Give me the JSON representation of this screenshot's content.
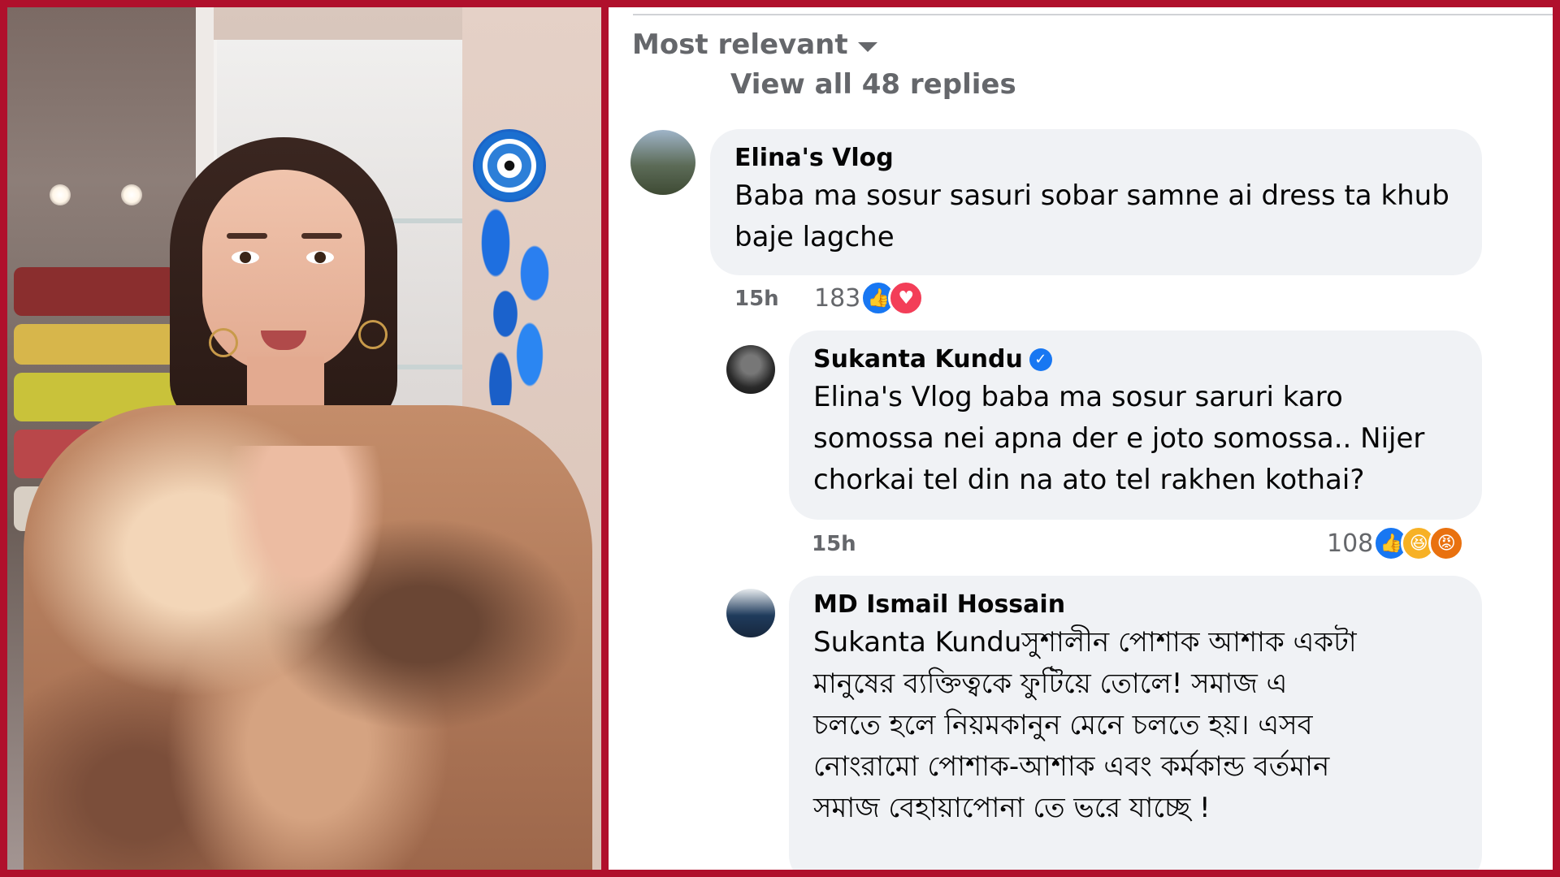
{
  "comments_section": {
    "sort_label": "Most relevant",
    "view_replies": "View all 48 replies",
    "comments": [
      {
        "author": "Elina's Vlog",
        "lines": [
          "Baba ma sosur sasuri sobar samne ai dress ta khub",
          "baje lagche"
        ],
        "time": "15h",
        "reaction_count": "183",
        "reactions": [
          "like-icon",
          "love-icon"
        ],
        "verified": false
      },
      {
        "author": "Sukanta Kundu",
        "lines": [
          "Elina's Vlog baba ma sosur saruri karo",
          "somossa nei apna der e joto somossa.. Nijer",
          "chorkai tel din na ato tel rakhen kothai?"
        ],
        "time": "15h",
        "reaction_count": "108",
        "reactions": [
          "like-icon",
          "haha-icon",
          "angry-icon"
        ],
        "verified": true
      },
      {
        "author": "MD Ismail Hossain",
        "lines": [
          "Sukanta Kunduসুশালীন পোশাক আশাক একটা",
          "মানুষের ব্যক্তিত্বকে ফুটিয়ে তোলে! সমাজ এ",
          "চলতে হলে নিয়মকানুন মেনে চলতে হয়। এসব",
          "নোংরামো পোশাক-আশাক এবং কর্মকান্ড বর্তমান",
          "সমাজ বেহায়াপোনা তে ভরে যাচ্ছে !"
        ],
        "verified": false
      }
    ]
  },
  "colors": {
    "frame": "#b0102c",
    "bubble": "#f0f2f5",
    "meta_text": "#65676b",
    "like": "#1877f2",
    "love": "#f33e58",
    "haha": "#f7b125",
    "angry": "#e9710f"
  }
}
